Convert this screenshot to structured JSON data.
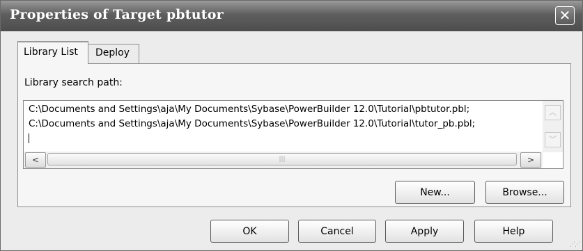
{
  "window": {
    "title": "Properties of Target pbtutor",
    "close_symbol": "✕"
  },
  "tabs": [
    {
      "label": "Library List",
      "active": true
    },
    {
      "label": "Deploy",
      "active": false
    }
  ],
  "library": {
    "label": "Library search path:",
    "lines": [
      "C:\\Documents and Settings\\aja\\My Documents\\Sybase\\PowerBuilder 12.0\\Tutorial\\pbtutor.pbl;",
      "C:\\Documents and Settings\\aja\\My Documents\\Sybase\\PowerBuilder 12.0\\Tutorial\\tutor_pb.pbl;"
    ]
  },
  "buttons": {
    "new": "New...",
    "browse": "Browse...",
    "ok": "OK",
    "cancel": "Cancel",
    "apply": "Apply",
    "help": "Help"
  },
  "icons": {
    "scroll_up": "scroll-up-arrow",
    "scroll_down": "scroll-down-arrow",
    "scroll_left": "scroll-left-arrow",
    "scroll_right": "scroll-right-arrow"
  }
}
